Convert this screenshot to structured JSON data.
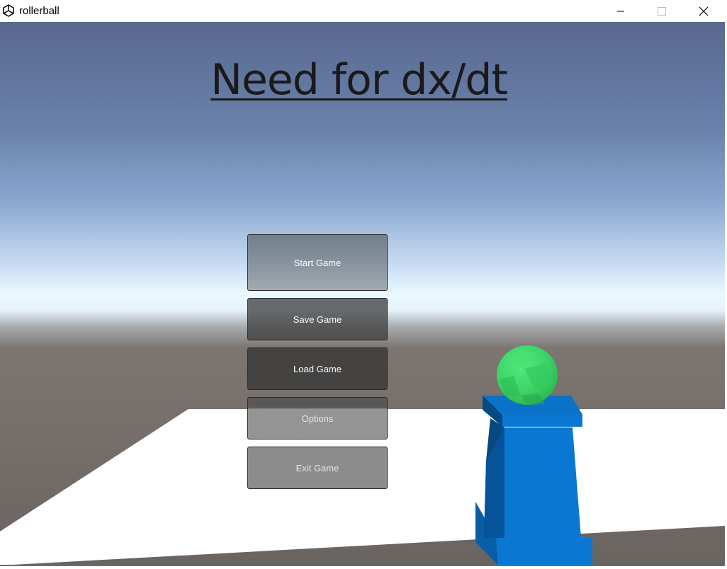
{
  "window": {
    "title": "rollerball",
    "icon": "unity-icon",
    "controls": {
      "minimize_icon": "minimize-icon",
      "maximize_icon": "maximize-icon",
      "close_icon": "close-icon"
    }
  },
  "game": {
    "title": "Need for dx/dt",
    "menu": {
      "start": "Start Game",
      "save": "Save Game",
      "load": "Load Game",
      "options": "Options",
      "exit": "Exit Game"
    }
  },
  "scene": {
    "sky_top_color": "#5a6f98",
    "horizon_color": "#e8f6ff",
    "ground_color": "#6d655f",
    "floor_color": "#ffffff",
    "pedestal_color": "#0a78d2",
    "ball_color": "#3fd86a"
  }
}
